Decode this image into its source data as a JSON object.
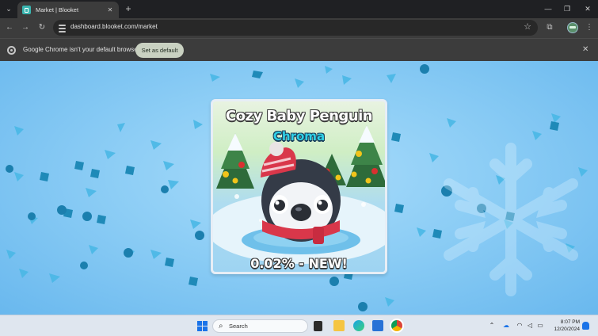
{
  "browser": {
    "tab_title": "Market | Blooket",
    "tab_close": "✕",
    "new_tab": "+",
    "url": "dashboard.blooket.com/market"
  },
  "infobar": {
    "message": "Google Chrome isn't your default browser",
    "button": "Set as default"
  },
  "card": {
    "title": "Cozy Baby Penguin",
    "subtitle": "Chroma",
    "rarity": "0.02% - NEW!"
  },
  "taskbar": {
    "search_placeholder": "Search",
    "time": "8:07 PM",
    "date": "12/20/2024"
  },
  "colors": {
    "background": "#8ccdf5",
    "chroma_text": "#2fd0e6",
    "default_button": "#c9d1c1"
  }
}
